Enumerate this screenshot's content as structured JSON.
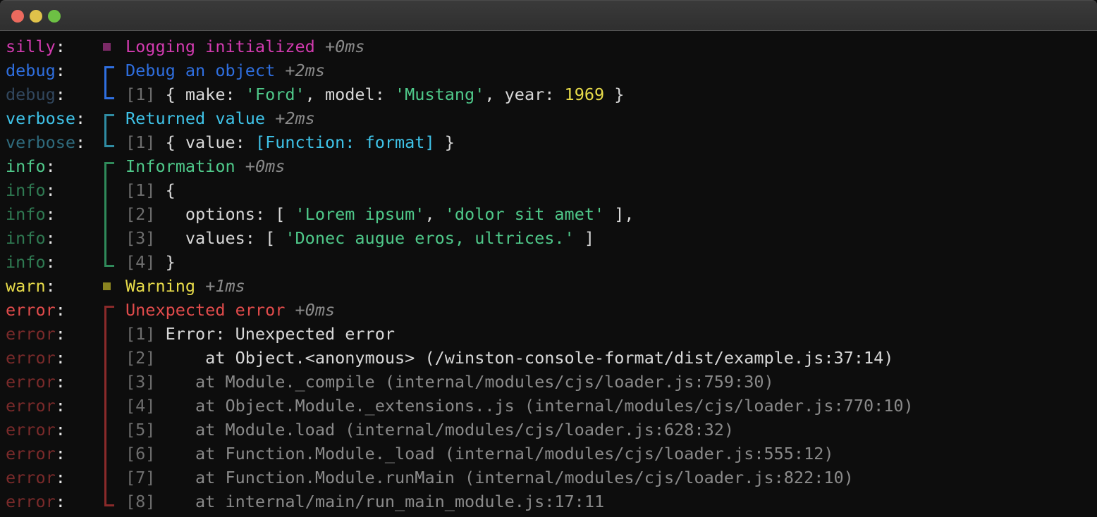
{
  "window": {
    "traffic_lights": [
      {
        "name": "close",
        "color": "#ec6a5e"
      },
      {
        "name": "minimize",
        "color": "#e0c24a"
      },
      {
        "name": "maximize",
        "color": "#6dc044"
      }
    ]
  },
  "colors": {
    "background": "#0d0d0d",
    "titlebar": "#333333",
    "silly": "#d33bb0",
    "silly_dim": "#7a2a66",
    "debug": "#2f6fe0",
    "debug_dim": "#31475e",
    "verbose": "#3fc3e8",
    "verbose_dim": "#2f6b7d",
    "info": "#4fc98a",
    "info_dim": "#2f7a52",
    "warn": "#e8dc4a",
    "warn_dim": "#8a8420",
    "error": "#e04b4b",
    "error_dim": "#7a2a2a",
    "text": "#d8d8d8",
    "text_dim": "#8a8a8a",
    "string": "#4fc98a",
    "number": "#e8dc4a",
    "function": "#3fc3e8",
    "linenum": "#6e6e6e",
    "timestamp": "#8a8a8a"
  },
  "log": [
    {
      "level": "silly",
      "level_text": "silly",
      "marker": "square",
      "marker_color": "#7a2a66",
      "dim": false,
      "segments": [
        {
          "text": "Logging initialized",
          "color": "#d33bb0"
        },
        {
          "text": " ",
          "color": "#d8d8d8"
        },
        {
          "text": "+0ms",
          "color": "#8a8a8a",
          "italic": true
        }
      ]
    },
    {
      "level": "debug",
      "level_text": "debug",
      "marker": "bracket-top",
      "marker_color": "#2f6fe0",
      "dim": false,
      "segments": [
        {
          "text": "Debug an object",
          "color": "#2f6fe0"
        },
        {
          "text": " ",
          "color": "#d8d8d8"
        },
        {
          "text": "+2ms",
          "color": "#8a8a8a",
          "italic": true
        }
      ]
    },
    {
      "level": "debug",
      "level_text": "debug",
      "marker": "bracket-bottom",
      "marker_color": "#2f6fe0",
      "dim": true,
      "segments": [
        {
          "text": "[1] ",
          "color": "#6e6e6e"
        },
        {
          "text": "{ make: ",
          "color": "#d8d8d8"
        },
        {
          "text": "'Ford'",
          "color": "#4fc98a"
        },
        {
          "text": ", model: ",
          "color": "#d8d8d8"
        },
        {
          "text": "'Mustang'",
          "color": "#4fc98a"
        },
        {
          "text": ", year: ",
          "color": "#d8d8d8"
        },
        {
          "text": "1969",
          "color": "#e8dc4a"
        },
        {
          "text": " }",
          "color": "#d8d8d8"
        }
      ]
    },
    {
      "level": "verbose",
      "level_text": "verbose",
      "marker": "bracket-top",
      "marker_color": "#2f8ca3",
      "dim": false,
      "segments": [
        {
          "text": "Returned value",
          "color": "#3fc3e8"
        },
        {
          "text": " ",
          "color": "#d8d8d8"
        },
        {
          "text": "+2ms",
          "color": "#8a8a8a",
          "italic": true
        }
      ]
    },
    {
      "level": "verbose",
      "level_text": "verbose",
      "marker": "bracket-bottom",
      "marker_color": "#2f8ca3",
      "dim": true,
      "segments": [
        {
          "text": "[1] ",
          "color": "#6e6e6e"
        },
        {
          "text": "{ value: ",
          "color": "#d8d8d8"
        },
        {
          "text": "[Function: format]",
          "color": "#3fc3e8"
        },
        {
          "text": " }",
          "color": "#d8d8d8"
        }
      ]
    },
    {
      "level": "info",
      "level_text": "info",
      "marker": "bracket-top",
      "marker_color": "#2f8a5a",
      "dim": false,
      "segments": [
        {
          "text": "Information",
          "color": "#4fc98a"
        },
        {
          "text": " ",
          "color": "#d8d8d8"
        },
        {
          "text": "+0ms",
          "color": "#8a8a8a",
          "italic": true
        }
      ]
    },
    {
      "level": "info",
      "level_text": "info",
      "marker": "bracket-mid",
      "marker_color": "#2f8a5a",
      "dim": true,
      "segments": [
        {
          "text": "[1] ",
          "color": "#6e6e6e"
        },
        {
          "text": "{",
          "color": "#d8d8d8"
        }
      ]
    },
    {
      "level": "info",
      "level_text": "info",
      "marker": "bracket-mid",
      "marker_color": "#2f8a5a",
      "dim": true,
      "segments": [
        {
          "text": "[2] ",
          "color": "#6e6e6e"
        },
        {
          "text": "  options: [ ",
          "color": "#d8d8d8"
        },
        {
          "text": "'Lorem ipsum'",
          "color": "#4fc98a"
        },
        {
          "text": ", ",
          "color": "#d8d8d8"
        },
        {
          "text": "'dolor sit amet'",
          "color": "#4fc98a"
        },
        {
          "text": " ],",
          "color": "#d8d8d8"
        }
      ]
    },
    {
      "level": "info",
      "level_text": "info",
      "marker": "bracket-mid",
      "marker_color": "#2f8a5a",
      "dim": true,
      "segments": [
        {
          "text": "[3] ",
          "color": "#6e6e6e"
        },
        {
          "text": "  values: [ ",
          "color": "#d8d8d8"
        },
        {
          "text": "'Donec augue eros, ultrices.'",
          "color": "#4fc98a"
        },
        {
          "text": " ]",
          "color": "#d8d8d8"
        }
      ]
    },
    {
      "level": "info",
      "level_text": "info",
      "marker": "bracket-bottom",
      "marker_color": "#2f8a5a",
      "dim": true,
      "segments": [
        {
          "text": "[4] ",
          "color": "#6e6e6e"
        },
        {
          "text": "}",
          "color": "#d8d8d8"
        }
      ]
    },
    {
      "level": "warn",
      "level_text": "warn",
      "marker": "square",
      "marker_color": "#8a8420",
      "dim": false,
      "segments": [
        {
          "text": "Warning",
          "color": "#e8dc4a"
        },
        {
          "text": " ",
          "color": "#d8d8d8"
        },
        {
          "text": "+1ms",
          "color": "#8a8a8a",
          "italic": true
        }
      ]
    },
    {
      "level": "error",
      "level_text": "error",
      "marker": "bracket-top",
      "marker_color": "#8a2a2a",
      "dim": false,
      "segments": [
        {
          "text": "Unexpected error",
          "color": "#e04b4b"
        },
        {
          "text": " ",
          "color": "#d8d8d8"
        },
        {
          "text": "+0ms",
          "color": "#8a8a8a",
          "italic": true
        }
      ]
    },
    {
      "level": "error",
      "level_text": "error",
      "marker": "bracket-mid",
      "marker_color": "#8a2a2a",
      "dim": true,
      "segments": [
        {
          "text": "[1] ",
          "color": "#6e6e6e"
        },
        {
          "text": "Error: Unexpected error",
          "color": "#d8d8d8"
        }
      ]
    },
    {
      "level": "error",
      "level_text": "error",
      "marker": "bracket-mid",
      "marker_color": "#8a2a2a",
      "dim": true,
      "segments": [
        {
          "text": "[2] ",
          "color": "#6e6e6e"
        },
        {
          "text": "    at Object.<anonymous> (/winston-console-format/dist/example.js:37:14)",
          "color": "#d8d8d8"
        }
      ]
    },
    {
      "level": "error",
      "level_text": "error",
      "marker": "bracket-mid",
      "marker_color": "#8a2a2a",
      "dim": true,
      "segments": [
        {
          "text": "[3] ",
          "color": "#6e6e6e"
        },
        {
          "text": "   at Module._compile (internal/modules/cjs/loader.js:759:30)",
          "color": "#8a8a8a"
        }
      ]
    },
    {
      "level": "error",
      "level_text": "error",
      "marker": "bracket-mid",
      "marker_color": "#8a2a2a",
      "dim": true,
      "segments": [
        {
          "text": "[4] ",
          "color": "#6e6e6e"
        },
        {
          "text": "   at Object.Module._extensions..js (internal/modules/cjs/loader.js:770:10)",
          "color": "#8a8a8a"
        }
      ]
    },
    {
      "level": "error",
      "level_text": "error",
      "marker": "bracket-mid",
      "marker_color": "#8a2a2a",
      "dim": true,
      "segments": [
        {
          "text": "[5] ",
          "color": "#6e6e6e"
        },
        {
          "text": "   at Module.load (internal/modules/cjs/loader.js:628:32)",
          "color": "#8a8a8a"
        }
      ]
    },
    {
      "level": "error",
      "level_text": "error",
      "marker": "bracket-mid",
      "marker_color": "#8a2a2a",
      "dim": true,
      "segments": [
        {
          "text": "[6] ",
          "color": "#6e6e6e"
        },
        {
          "text": "   at Function.Module._load (internal/modules/cjs/loader.js:555:12)",
          "color": "#8a8a8a"
        }
      ]
    },
    {
      "level": "error",
      "level_text": "error",
      "marker": "bracket-mid",
      "marker_color": "#8a2a2a",
      "dim": true,
      "segments": [
        {
          "text": "[7] ",
          "color": "#6e6e6e"
        },
        {
          "text": "   at Function.Module.runMain (internal/modules/cjs/loader.js:822:10)",
          "color": "#8a8a8a"
        }
      ]
    },
    {
      "level": "error",
      "level_text": "error",
      "marker": "bracket-bottom",
      "marker_color": "#8a2a2a",
      "dim": true,
      "segments": [
        {
          "text": "[8] ",
          "color": "#6e6e6e"
        },
        {
          "text": "   at internal/main/run_main_module.js:17:11",
          "color": "#8a8a8a"
        }
      ]
    }
  ],
  "level_colors": {
    "silly": {
      "bright": "#d33bb0",
      "dim": "#7a2a66"
    },
    "debug": {
      "bright": "#2f6fe0",
      "dim": "#31475e"
    },
    "verbose": {
      "bright": "#3fc3e8",
      "dim": "#2f6b7d"
    },
    "info": {
      "bright": "#4fc98a",
      "dim": "#2f7a52"
    },
    "warn": {
      "bright": "#e8dc4a",
      "dim": "#8a8420"
    },
    "error": {
      "bright": "#e04b4b",
      "dim": "#7a2a2a"
    }
  }
}
